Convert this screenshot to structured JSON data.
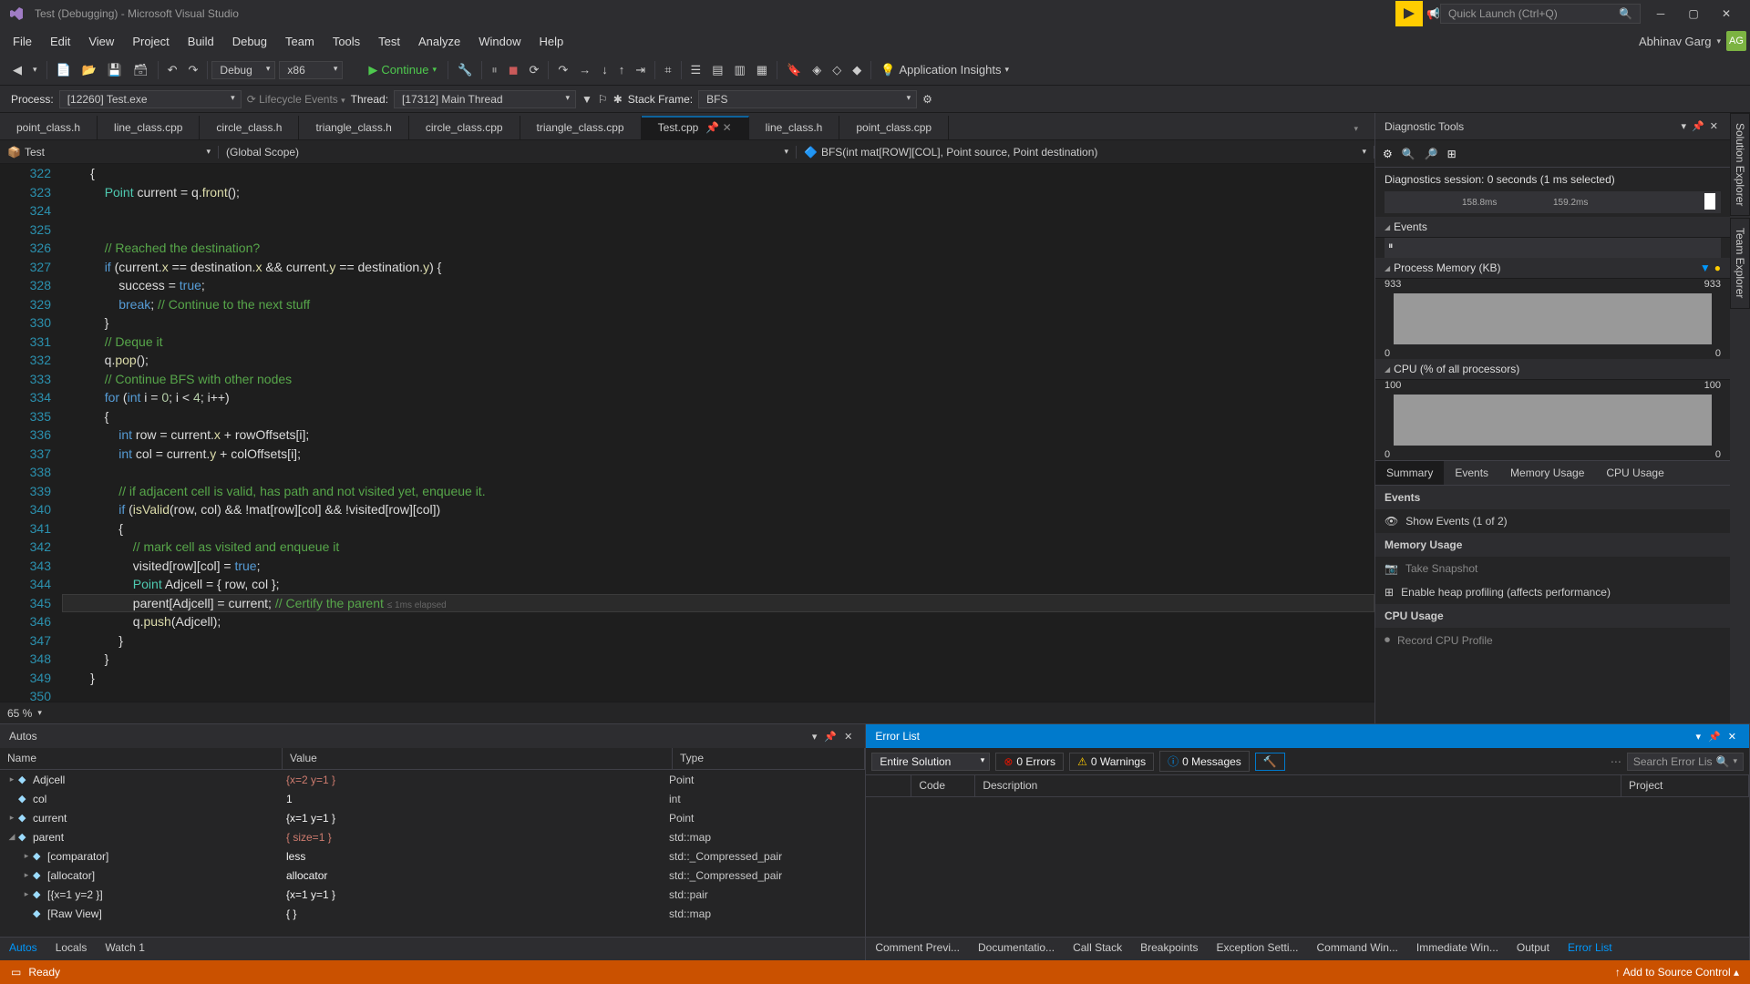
{
  "title": "Test (Debugging) - Microsoft Visual Studio",
  "quick_launch_placeholder": "Quick Launch (Ctrl+Q)",
  "menu": [
    "File",
    "Edit",
    "View",
    "Project",
    "Build",
    "Debug",
    "Team",
    "Tools",
    "Test",
    "Analyze",
    "Window",
    "Help"
  ],
  "user": {
    "name": "Abhinav Garg",
    "initials": "AG"
  },
  "toolbar": {
    "config": "Debug",
    "platform": "x86",
    "continue": "Continue",
    "insights": "Application Insights"
  },
  "debug_bar": {
    "process_label": "Process:",
    "process": "[12260] Test.exe",
    "lifecycle": "Lifecycle Events",
    "thread_label": "Thread:",
    "thread": "[17312] Main Thread",
    "stack_label": "Stack Frame:",
    "stack": "BFS"
  },
  "tabs": [
    {
      "label": "point_class.h"
    },
    {
      "label": "line_class.cpp"
    },
    {
      "label": "circle_class.h"
    },
    {
      "label": "triangle_class.h"
    },
    {
      "label": "circle_class.cpp"
    },
    {
      "label": "triangle_class.cpp"
    },
    {
      "label": "Test.cpp",
      "active": true
    },
    {
      "label": "line_class.h"
    },
    {
      "label": "point_class.cpp"
    }
  ],
  "nav": {
    "project": "Test",
    "scope": "(Global Scope)",
    "symbol": "BFS(int mat[ROW][COL], Point source, Point destination)"
  },
  "zoom": "65 %",
  "code_lines": [
    {
      "n": 322,
      "t": "        {"
    },
    {
      "n": 323,
      "html": "            <span class='tp'>Point</span> current = q.<span class='fn'>front</span>();"
    },
    {
      "n": 324,
      "t": ""
    },
    {
      "n": 325,
      "t": ""
    },
    {
      "n": 326,
      "html": "            <span class='cm'>// Reached the destination?</span>"
    },
    {
      "n": 327,
      "html": "            <span class='kw'>if</span> (current.<span class='mem'>x</span> == destination.<span class='mem'>x</span> && current.<span class='mem'>y</span> == destination.<span class='mem'>y</span>) {"
    },
    {
      "n": 328,
      "html": "                success = <span class='kw'>true</span>;"
    },
    {
      "n": 329,
      "html": "                <span class='kw'>break</span>; <span class='cm'>// Continue to the next stuff</span>"
    },
    {
      "n": 330,
      "t": "            }"
    },
    {
      "n": 331,
      "html": "            <span class='cm'>// Deque it</span>"
    },
    {
      "n": 332,
      "html": "            q.<span class='fn'>pop</span>();"
    },
    {
      "n": 333,
      "html": "            <span class='cm'>// Continue BFS with other nodes</span>"
    },
    {
      "n": 334,
      "html": "            <span class='kw'>for</span> (<span class='kw'>int</span> i = <span class='nm'>0</span>; i &lt; <span class='nm'>4</span>; i++)"
    },
    {
      "n": 335,
      "t": "            {"
    },
    {
      "n": 336,
      "html": "                <span class='kw'>int</span> row = current.<span class='mem'>x</span> + rowOffsets[i];"
    },
    {
      "n": 337,
      "html": "                <span class='kw'>int</span> col = current.<span class='mem'>y</span> + colOffsets[i];"
    },
    {
      "n": 338,
      "t": ""
    },
    {
      "n": 339,
      "html": "                <span class='cm'>// if adjacent cell is valid, has path and not visited yet, enqueue it.</span>"
    },
    {
      "n": 340,
      "html": "                <span class='kw'>if</span> (<span class='fn'>isValid</span>(row, col) && !mat[row][col] && !visited[row][col])"
    },
    {
      "n": 341,
      "t": "                {"
    },
    {
      "n": 342,
      "html": "                    <span class='cm'>// mark cell as visited and enqueue it</span>"
    },
    {
      "n": 343,
      "html": "                    visited[row][col] = <span class='kw'>true</span>;"
    },
    {
      "n": 344,
      "html": "                    <span class='tp'>Point</span> Adjcell = { row, col };"
    },
    {
      "n": 345,
      "cur": true,
      "bp": true,
      "html": "                    parent[Adjcell] = current; <span class='cm'>// Certify the parent</span> <span class='elapsed'>≤ 1ms elapsed</span>"
    },
    {
      "n": 346,
      "html": "                    q.<span class='fn'>push</span>(Adjcell);"
    },
    {
      "n": 347,
      "t": "                }"
    },
    {
      "n": 348,
      "t": "            }"
    },
    {
      "n": 349,
      "t": "        }"
    },
    {
      "n": 350,
      "t": ""
    }
  ],
  "diag": {
    "title": "Diagnostic Tools",
    "session": "Diagnostics session: 0 seconds (1 ms selected)",
    "time_marks": [
      "158.8ms",
      "159.2ms"
    ],
    "sections": {
      "events": "Events",
      "memory": "Process Memory (KB)",
      "memory_vals": [
        "933",
        "933",
        "0",
        "0"
      ],
      "cpu": "CPU (% of all processors)",
      "cpu_vals": [
        "100",
        "100",
        "0",
        "0"
      ]
    },
    "tabs": [
      "Summary",
      "Events",
      "Memory Usage",
      "CPU Usage"
    ],
    "summary": {
      "events_header": "Events",
      "show_events": "Show Events (1 of 2)",
      "memory_header": "Memory Usage",
      "snapshot": "Take Snapshot",
      "heap": "Enable heap profiling (affects performance)",
      "cpu_header": "CPU Usage",
      "record": "Record CPU Profile"
    }
  },
  "autos": {
    "title": "Autos",
    "cols": [
      "Name",
      "Value",
      "Type"
    ],
    "rows": [
      {
        "exp": "▸",
        "name": "Adjcell",
        "val": "{x=2 y=1 }",
        "red": true,
        "type": "Point",
        "indent": 0
      },
      {
        "exp": "",
        "name": "col",
        "val": "1",
        "red": false,
        "type": "int",
        "indent": 0
      },
      {
        "exp": "▸",
        "name": "current",
        "val": "{x=1 y=1 }",
        "red": false,
        "type": "Point",
        "indent": 0
      },
      {
        "exp": "◢",
        "name": "parent",
        "val": "{ size=1 }",
        "red": true,
        "type": "std::map<Point,Point,s",
        "indent": 0
      },
      {
        "exp": "▸",
        "name": "[comparator]",
        "val": "less",
        "red": false,
        "type": "std::_Compressed_pair",
        "indent": 1
      },
      {
        "exp": "▸",
        "name": "[allocator]",
        "val": "allocator",
        "red": false,
        "type": "std::_Compressed_pair",
        "indent": 1
      },
      {
        "exp": "▸",
        "name": "[{x=1 y=2 }]",
        "val": "{x=1 y=1 }",
        "red": false,
        "type": "std::pair<Point const ,I",
        "indent": 1
      },
      {
        "exp": "",
        "name": "[Raw View]",
        "val": "{ }",
        "red": false,
        "type": "std::map<Point Point s",
        "indent": 1
      }
    ],
    "tabs": [
      "Autos",
      "Locals",
      "Watch 1"
    ]
  },
  "errors": {
    "title": "Error List",
    "scope": "Entire Solution",
    "counts": {
      "errors": "0 Errors",
      "warnings": "0 Warnings",
      "messages": "0 Messages"
    },
    "search_placeholder": "Search Error Lis",
    "cols": [
      "",
      "Code",
      "Description",
      "Project"
    ]
  },
  "bottom_tabs_right": [
    "Comment Previ...",
    "Documentatio...",
    "Call Stack",
    "Breakpoints",
    "Exception Setti...",
    "Command Win...",
    "Immediate Win...",
    "Output",
    "Error List"
  ],
  "status": {
    "ready": "Ready",
    "source_control": "Add to Source Control"
  },
  "side_tabs": [
    "Solution Explorer",
    "Team Explorer"
  ]
}
